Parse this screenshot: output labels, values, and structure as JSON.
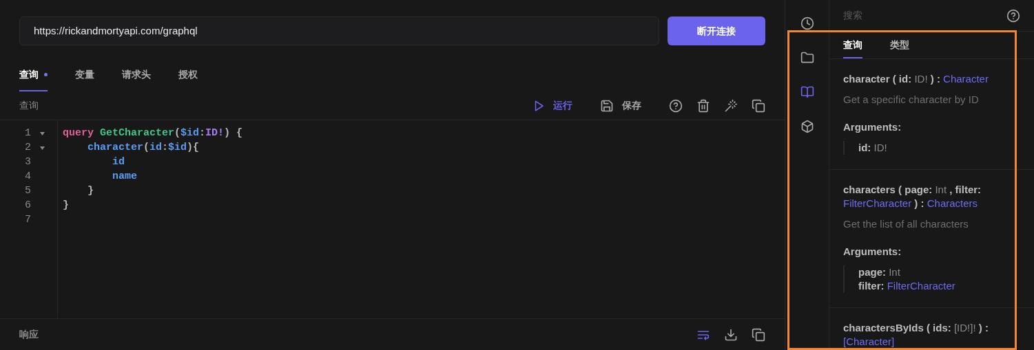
{
  "url_field": {
    "value": "https://rickandmortyapi.com/graphql"
  },
  "connect_button": {
    "label": "断开连接"
  },
  "tabs": [
    {
      "label": "查询",
      "selected": true,
      "modified": true
    },
    {
      "label": "变量",
      "selected": false,
      "modified": false
    },
    {
      "label": "请求头",
      "selected": false,
      "modified": false
    },
    {
      "label": "授权",
      "selected": false,
      "modified": false
    }
  ],
  "editor_section": {
    "title": "查询",
    "run_label": "运行",
    "save_label": "保存"
  },
  "code_lines": [
    {
      "number": "1",
      "foldable": true,
      "tokens": [
        {
          "text": "query ",
          "kind": "keyword"
        },
        {
          "text": "GetCharacter",
          "kind": "def"
        },
        {
          "text": "(",
          "kind": "punct"
        },
        {
          "text": "$id",
          "kind": "variable"
        },
        {
          "text": ":",
          "kind": "punct"
        },
        {
          "text": "ID!",
          "kind": "type"
        },
        {
          "text": ") {",
          "kind": "punct"
        }
      ],
      "children": [
        {
          "number": "2",
          "foldable": true,
          "tokens": [
            {
              "text": "character",
              "kind": "field"
            },
            {
              "text": "(",
              "kind": "punct"
            },
            {
              "text": "id",
              "kind": "field"
            },
            {
              "text": ":",
              "kind": "punct"
            },
            {
              "text": "$id",
              "kind": "variable"
            },
            {
              "text": "){",
              "kind": "punct"
            }
          ],
          "children": [
            {
              "number": "3",
              "foldable": false,
              "tokens": [
                {
                  "text": "id",
                  "kind": "field"
                }
              ]
            },
            {
              "number": "4",
              "foldable": false,
              "tokens": [
                {
                  "text": "name",
                  "kind": "field"
                }
              ]
            }
          ]
        },
        {
          "number": "5",
          "foldable": false,
          "tokens": [
            {
              "text": "}",
              "kind": "punct"
            }
          ]
        }
      ]
    },
    {
      "number": "6",
      "foldable": false,
      "tokens": [
        {
          "text": "}",
          "kind": "punct"
        }
      ]
    },
    {
      "number": "7",
      "foldable": false
    }
  ],
  "response_bar": {
    "title": "响应"
  },
  "rail": [
    {
      "kind": "clock",
      "selected": false
    },
    {
      "kind": "folder",
      "selected": false
    },
    {
      "kind": "book",
      "selected": true
    },
    {
      "kind": "cube",
      "selected": false
    }
  ],
  "docs": {
    "search_placeholder": "搜索",
    "tabs": [
      {
        "label": "查询",
        "selected": true
      },
      {
        "label": "类型",
        "selected": false
      }
    ],
    "entries": [
      {
        "signature": [
          {
            "text": "character ( id: ",
            "kind": "name"
          },
          {
            "text": "ID!",
            "kind": "scalar"
          },
          {
            "text": " ) : ",
            "kind": "name"
          },
          {
            "text": "Character",
            "kind": "type"
          }
        ],
        "description": "Get a specific character by ID",
        "arguments_label": "Arguments:",
        "arguments": [
          {
            "name": "id:",
            "type": "ID!",
            "kind": "scalar"
          }
        ]
      },
      {
        "signature": [
          {
            "text": "characters ( page: ",
            "kind": "name"
          },
          {
            "text": "Int",
            "kind": "scalar"
          },
          {
            "text": " , filter: ",
            "kind": "name"
          },
          {
            "text": "FilterCharacter",
            "kind": "type"
          },
          {
            "text": " ) : ",
            "kind": "name"
          },
          {
            "text": "Characters",
            "kind": "type"
          }
        ],
        "description": "Get the list of all characters",
        "arguments_label": "Arguments:",
        "arguments": [
          {
            "name": "page:",
            "type": "Int",
            "kind": "scalar"
          },
          {
            "name": "filter:",
            "type": "FilterCharacter",
            "kind": "type"
          }
        ]
      },
      {
        "signature": [
          {
            "text": "charactersByIds ( ids: ",
            "kind": "name"
          },
          {
            "text": "[ID!]!",
            "kind": "scalar"
          },
          {
            "text": " ) : ",
            "kind": "name"
          },
          {
            "text": "[Character]",
            "kind": "type"
          }
        ]
      }
    ]
  }
}
